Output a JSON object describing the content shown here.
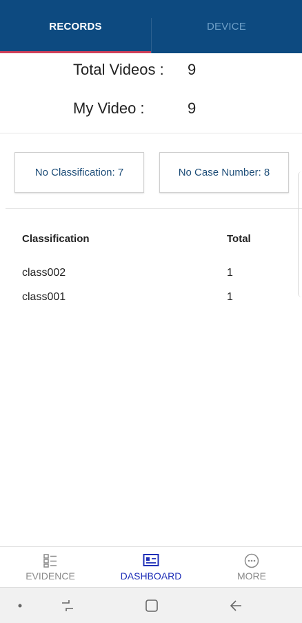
{
  "tabs": {
    "records": "RECORDS",
    "device": "DEVICE"
  },
  "summary": {
    "total_videos_label": "Total Videos :",
    "total_videos_value": "9",
    "my_video_label": "My Video :",
    "my_video_value": "9"
  },
  "cards": {
    "no_classification": "No Classification:  7",
    "no_case_number": "No Case Number: 8"
  },
  "table": {
    "headers": [
      "Classification",
      "Total"
    ],
    "rows": [
      [
        "class002",
        "1"
      ],
      [
        "class001",
        "1"
      ]
    ]
  },
  "bottom_nav": {
    "items": [
      "EVIDENCE",
      "DASHBOARD",
      "MORE"
    ],
    "active": "DASHBOARD"
  },
  "colors": {
    "header": "#0d4a80",
    "tab_indicator": "#d0405a",
    "active_nav": "#1f2fb8",
    "card_text": "#1d4d78"
  },
  "icons": [
    "evidence-list-icon",
    "dashboard-icon",
    "more-dots-icon",
    "recent-apps-icon",
    "home-icon",
    "back-icon"
  ]
}
